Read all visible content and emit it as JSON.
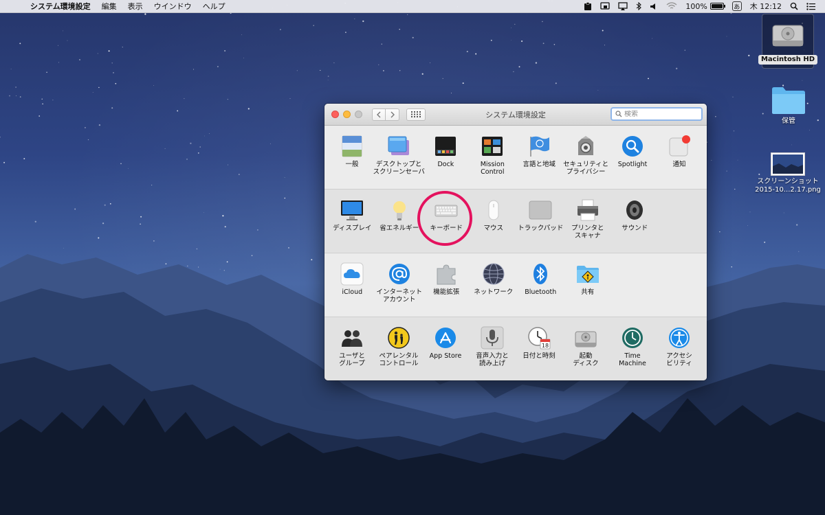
{
  "menubar": {
    "app_name": "システム環境設定",
    "items": [
      "編集",
      "表示",
      "ウインドウ",
      "ヘルプ"
    ],
    "battery": "100%",
    "ime": "あ",
    "clock": "木 12:12"
  },
  "desktop": {
    "items": [
      {
        "label": "Macintosh HD"
      },
      {
        "label": "保管"
      },
      {
        "label": "スクリーンショット"
      },
      {
        "label": "2015-10...2.17.png"
      }
    ]
  },
  "window": {
    "title": "システム環境設定",
    "search_placeholder": "検索",
    "rows": [
      [
        {
          "label": "一般",
          "icon": "general-icon"
        },
        {
          "label": "デスクトップと\nスクリーンセーバ",
          "icon": "desktop-screensaver-icon"
        },
        {
          "label": "Dock",
          "icon": "dock-icon"
        },
        {
          "label": "Mission\nControl",
          "icon": "mission-control-icon"
        },
        {
          "label": "言語と地域",
          "icon": "language-region-icon"
        },
        {
          "label": "セキュリティと\nプライバシー",
          "icon": "security-icon"
        },
        {
          "label": "Spotlight",
          "icon": "spotlight-icon"
        },
        {
          "label": "通知",
          "icon": "notifications-icon"
        }
      ],
      [
        {
          "label": "ディスプレイ",
          "icon": "display-icon"
        },
        {
          "label": "省エネルギー",
          "icon": "energy-saver-icon"
        },
        {
          "label": "キーボード",
          "icon": "keyboard-icon"
        },
        {
          "label": "マウス",
          "icon": "mouse-icon"
        },
        {
          "label": "トラックパッド",
          "icon": "trackpad-icon"
        },
        {
          "label": "プリンタと\nスキャナ",
          "icon": "printer-icon"
        },
        {
          "label": "サウンド",
          "icon": "sound-icon"
        }
      ],
      [
        {
          "label": "iCloud",
          "icon": "icloud-icon"
        },
        {
          "label": "インターネット\nアカウント",
          "icon": "internet-accounts-icon"
        },
        {
          "label": "機能拡張",
          "icon": "extensions-icon"
        },
        {
          "label": "ネットワーク",
          "icon": "network-icon"
        },
        {
          "label": "Bluetooth",
          "icon": "bluetooth-icon"
        },
        {
          "label": "共有",
          "icon": "sharing-icon"
        }
      ],
      [
        {
          "label": "ユーザと\nグループ",
          "icon": "users-groups-icon"
        },
        {
          "label": "ペアレンタル\nコントロール",
          "icon": "parental-controls-icon"
        },
        {
          "label": "App Store",
          "icon": "app-store-icon"
        },
        {
          "label": "音声入力と\n読み上げ",
          "icon": "dictation-speech-icon"
        },
        {
          "label": "日付と時刻",
          "icon": "date-time-icon"
        },
        {
          "label": "起動\nディスク",
          "icon": "startup-disk-icon"
        },
        {
          "label": "Time\nMachine",
          "icon": "time-machine-icon"
        },
        {
          "label": "アクセシ\nビリティ",
          "icon": "accessibility-icon"
        }
      ]
    ],
    "calendar_day": "18"
  },
  "colors": {
    "highlight": "#e4125e",
    "search_focus": "#8fb6ea"
  }
}
